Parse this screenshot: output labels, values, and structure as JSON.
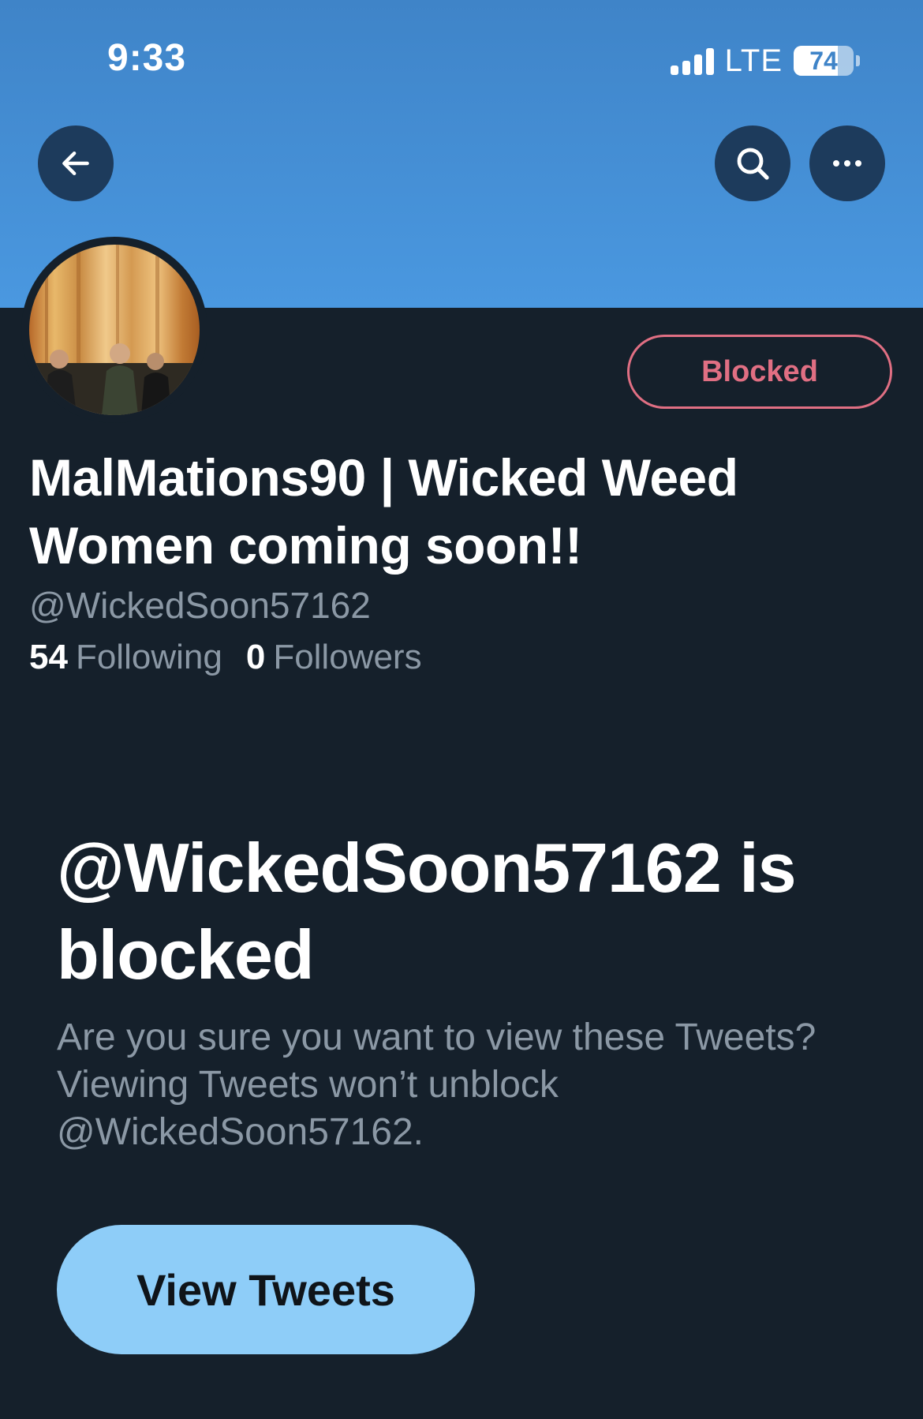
{
  "status_bar": {
    "time": "9:33",
    "network": "LTE",
    "battery": "74",
    "battery_level": 0.74
  },
  "header": {
    "back_icon": "arrow-left-icon",
    "search_icon": "search-icon",
    "more_icon": "more-horizontal-icon",
    "banner_color": "#4a98e0"
  },
  "profile": {
    "display_name": "MalMations90 | Wicked Weed Women coming soon!!",
    "handle": "@WickedSoon57162",
    "following_count": "54",
    "following_label": "Following",
    "followers_count": "0",
    "followers_label": "Followers",
    "blocked_button": "Blocked"
  },
  "blocked_notice": {
    "title": "@WickedSoon57162 is blocked",
    "description": "Are you sure you want to view these Tweets? Viewing Tweets won’t unblock @WickedSoon57162.",
    "view_button": "View Tweets"
  },
  "colors": {
    "background": "#15202b",
    "accent_blocked": "#e06f83",
    "view_button": "#8ecdf8",
    "secondary_text": "#8b98a5"
  }
}
